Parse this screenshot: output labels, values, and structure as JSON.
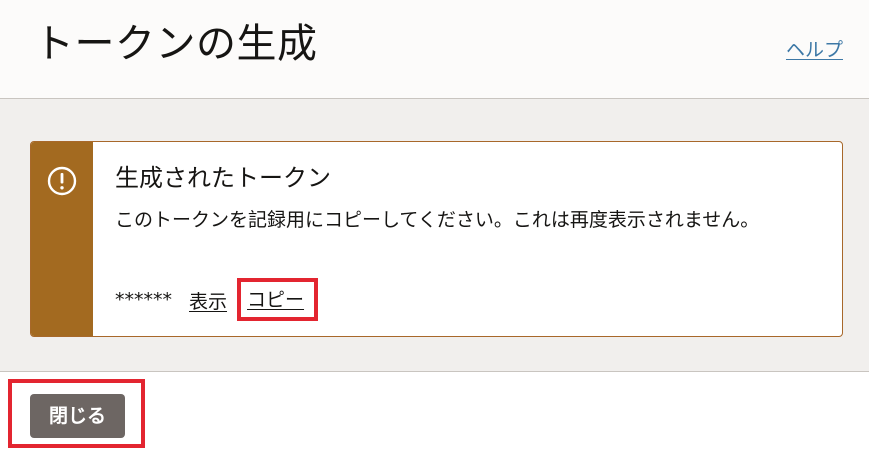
{
  "header": {
    "title": "トークンの生成",
    "help_link": "ヘルプ"
  },
  "message": {
    "title": "生成されたトークン",
    "text": "このトークンを記録用にコピーしてください。これは再度表示されません。",
    "icon": "warning-icon",
    "token_masked": "******",
    "show_link": "表示",
    "copy_link": "コピー"
  },
  "footer": {
    "close_label": "閉じる"
  },
  "colors": {
    "warning_accent": "#a36a20",
    "highlight": "#e32530",
    "button_bg": "#6d6663",
    "help_link": "#3d78a6"
  }
}
